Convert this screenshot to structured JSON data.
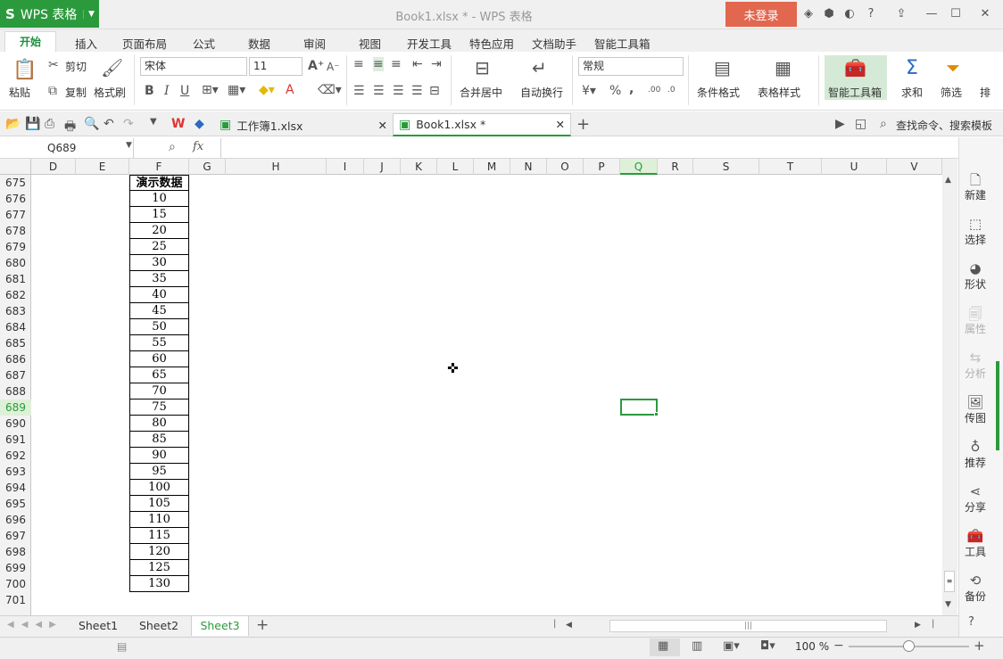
{
  "app": {
    "name": "WPS 表格",
    "logo": "S",
    "window_title": "Book1.xlsx * - WPS 表格",
    "login": "未登录"
  },
  "menu": [
    "开始",
    "插入",
    "页面布局",
    "公式",
    "数据",
    "审阅",
    "视图",
    "开发工具",
    "特色应用",
    "文档助手",
    "智能工具箱"
  ],
  "ribbon": {
    "paste": "粘贴",
    "cut": "剪切",
    "copy": "复制",
    "format_painter": "格式刷",
    "font_name": "宋体",
    "font_size": "11",
    "bold": "B",
    "italic": "I",
    "underline": "U",
    "font_color_glyph": "A",
    "merge_center": "合并居中",
    "wrap_text": "自动换行",
    "number_format": "常规",
    "percent": "%",
    "comma": ",",
    "cond_format": "条件格式",
    "table_style": "表格样式",
    "smart_toolbox": "智能工具箱",
    "sum": "求和",
    "filter": "筛选",
    "more": "排"
  },
  "doc_tabs": [
    {
      "name": "工作簿1.xlsx",
      "active": false
    },
    {
      "name": "Book1.xlsx *",
      "active": true
    }
  ],
  "search_command": "查找命令、搜索模板",
  "name_box": "Q689",
  "fx": "fx",
  "columns": [
    "D",
    "E",
    "F",
    "G",
    "H",
    "I",
    "J",
    "K",
    "L",
    "M",
    "N",
    "O",
    "P",
    "Q",
    "R",
    "S",
    "T",
    "U",
    "V"
  ],
  "selected_column": "Q",
  "rows": [
    "675",
    "676",
    "677",
    "678",
    "679",
    "680",
    "681",
    "682",
    "683",
    "684",
    "685",
    "686",
    "687",
    "688",
    "689",
    "690",
    "691",
    "692",
    "693",
    "694",
    "695",
    "696",
    "697",
    "698",
    "699",
    "700",
    "701"
  ],
  "selected_row": "689",
  "column_F": [
    "演示数据",
    "10",
    "15",
    "20",
    "25",
    "30",
    "35",
    "40",
    "45",
    "50",
    "55",
    "60",
    "65",
    "70",
    "75",
    "80",
    "85",
    "90",
    "95",
    "100",
    "105",
    "110",
    "115",
    "120",
    "125",
    "130"
  ],
  "side_panel": [
    "新建",
    "选择",
    "形状",
    "属性",
    "分析",
    "传图",
    "推荐",
    "分享",
    "工具",
    "备份"
  ],
  "sheets": [
    "Sheet1",
    "Sheet2",
    "Sheet3"
  ],
  "active_sheet": "Sheet3",
  "zoom": "100 %",
  "colors": {
    "accent": "#2b9a3d",
    "login": "#e2674f",
    "selection_header": "#dff0d8"
  }
}
